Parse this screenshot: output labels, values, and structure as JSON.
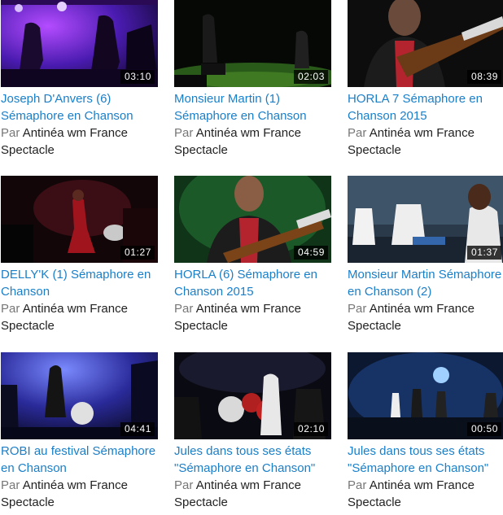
{
  "videos": [
    {
      "title": "Joseph D'Anvers (6) Sémaphore en Chanson",
      "duration": "03:10",
      "by_label": "Par",
      "author": "Antinéa wm France",
      "category": "Spectacle"
    },
    {
      "title": "Monsieur Martin (1) Sémaphore en Chanson",
      "duration": "02:03",
      "by_label": "Par",
      "author": "Antinéa wm France",
      "category": "Spectacle"
    },
    {
      "title": "HORLA 7 Sémaphore en Chanson 2015",
      "duration": "08:39",
      "by_label": "Par",
      "author": "Antinéa wm France",
      "category": "Spectacle"
    },
    {
      "title": "DELLY'K (1) Sémaphore en Chanson",
      "duration": "01:27",
      "by_label": "Par",
      "author": "Antinéa wm France",
      "category": "Spectacle"
    },
    {
      "title": "HORLA (6) Sémaphore en Chanson 2015",
      "duration": "04:59",
      "by_label": "Par",
      "author": "Antinéa wm France",
      "category": "Spectacle"
    },
    {
      "title": "Monsieur Martin Sémaphore en Chanson (2)",
      "duration": "01:37",
      "by_label": "Par",
      "author": "Antinéa wm France",
      "category": "Spectacle"
    },
    {
      "title": "ROBI au festival Sémaphore en Chanson",
      "duration": "04:41",
      "by_label": "Par",
      "author": "Antinéa wm France",
      "category": "Spectacle"
    },
    {
      "title": "Jules dans tous ses états \"Sémaphore en Chanson\"",
      "duration": "02:10",
      "by_label": "Par",
      "author": "Antinéa wm France",
      "category": "Spectacle"
    },
    {
      "title": "Jules dans tous ses états \"Sémaphore en Chanson\"",
      "duration": "00:50",
      "by_label": "Par",
      "author": "Antinéa wm France",
      "category": "Spectacle"
    }
  ],
  "colors": {
    "title_link": "#1a7fc9",
    "text": "#222222",
    "by_label": "#777777",
    "duration_bg": "#000000"
  }
}
